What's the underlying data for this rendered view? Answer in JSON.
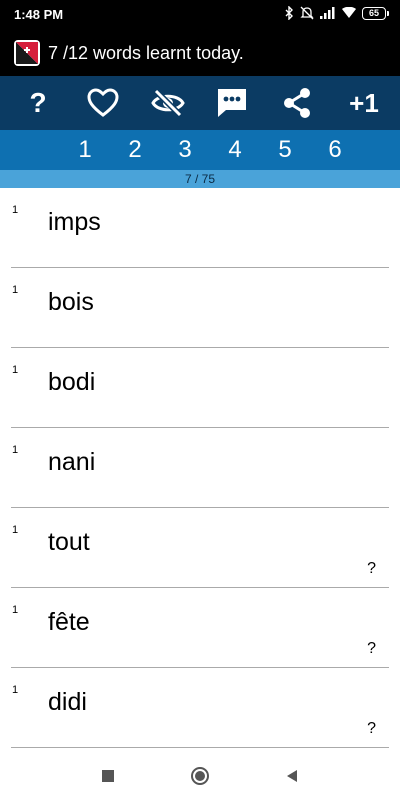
{
  "status_bar": {
    "time": "1:48 PM",
    "battery": "65",
    "icons": [
      "bluetooth-icon",
      "mute-icon",
      "signal-icon",
      "wifi-icon",
      "battery-icon"
    ]
  },
  "header": {
    "app_icon": "dictionary-app-icon",
    "title": "7 /12 words learnt today."
  },
  "toolbar": {
    "help_label": "?",
    "plus_label": "+1",
    "icons": [
      "help-icon",
      "heart-icon",
      "eye-off-icon",
      "comment-icon",
      "share-icon",
      "plus-one-icon"
    ],
    "background_color": "#0b3b63"
  },
  "level_tabs": [
    "1",
    "2",
    "3",
    "4",
    "5",
    "6"
  ],
  "progress": {
    "label": "7 / 75",
    "current": 7,
    "total": 75
  },
  "words": [
    {
      "count": "1",
      "text": "imps",
      "mark": ""
    },
    {
      "count": "1",
      "text": "bois",
      "mark": ""
    },
    {
      "count": "1",
      "text": "bodi",
      "mark": ""
    },
    {
      "count": "1",
      "text": "nani",
      "mark": ""
    },
    {
      "count": "1",
      "text": "tout",
      "mark": "?"
    },
    {
      "count": "1",
      "text": "fête",
      "mark": "?"
    },
    {
      "count": "1",
      "text": "didi",
      "mark": "?"
    }
  ],
  "nav_bar": {
    "icons": [
      "recents-icon",
      "home-icon",
      "back-icon"
    ]
  },
  "colors": {
    "tabs_background": "#0e70b1",
    "progress_background": "#4aa3d9"
  }
}
